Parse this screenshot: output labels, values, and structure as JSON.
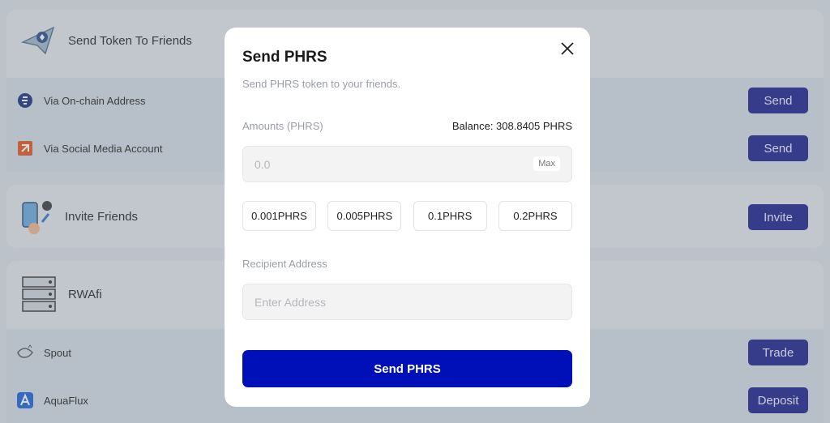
{
  "background": {
    "send_section": {
      "title": "Send Token To Friends",
      "rows": [
        {
          "label": "Via On-chain Address",
          "button": "Send"
        },
        {
          "label": "Via Social Media Account",
          "button": "Send"
        }
      ]
    },
    "invite_section": {
      "title": "Invite Friends",
      "button": "Invite"
    },
    "rwafi_section": {
      "title": "RWAfi",
      "rows": [
        {
          "label": "Spout",
          "button": "Trade"
        },
        {
          "label": "AquaFlux",
          "button": "Deposit"
        }
      ]
    }
  },
  "modal": {
    "title": "Send PHRS",
    "subtitle": "Send PHRS token to your friends.",
    "amount_label": "Amounts (PHRS)",
    "balance": "Balance: 308.8405 PHRS",
    "amount_placeholder": "0.0",
    "max_label": "Max",
    "presets": [
      "0.001PHRS",
      "0.005PHRS",
      "0.1PHRS",
      "0.2PHRS"
    ],
    "recipient_label": "Recipient Address",
    "recipient_placeholder": "Enter Address",
    "send_button": "Send PHRS"
  },
  "colors": {
    "accent": "#0010b8",
    "button_bg": "#1c1f8a",
    "overlay": "#c9d0d6"
  }
}
